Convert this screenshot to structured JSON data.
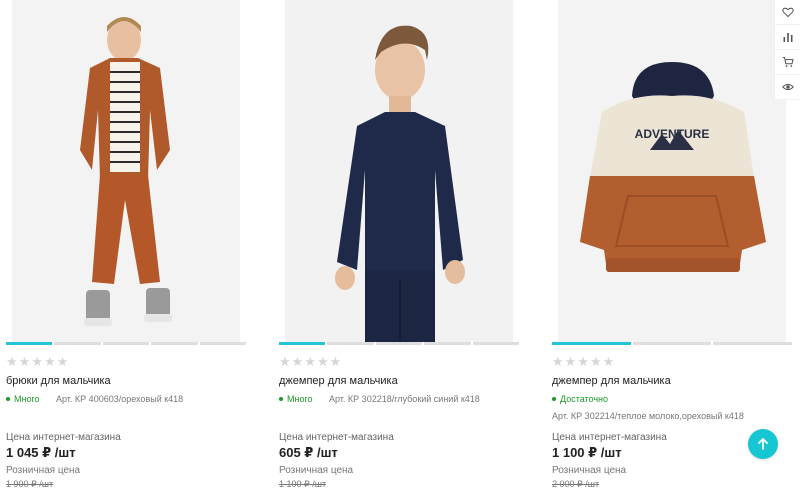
{
  "products": [
    {
      "title": "брюки для мальчика",
      "availability": "Много",
      "article": "Арт. КР 400603/ореховый к418",
      "price_label": "Цена интернет-магазина",
      "price": "1 045 ₽ /шт",
      "retail_label": "Розничная цена",
      "retail_price": "1 900 ₽ /шт",
      "image": "boy-in-brown-tracksuit-photo",
      "rating": 0
    },
    {
      "title": "джемпер для мальчика",
      "availability": "Много",
      "article": "Арт. КР 302218/глубокий синий к418",
      "price_label": "Цена интернет-магазина",
      "price": "605 ₽ /шт",
      "retail_label": "Розничная цена",
      "retail_price": "1 100 ₽ /шт",
      "image": "boy-in-navy-jumper-photo",
      "rating": 0
    },
    {
      "title": "джемпер для мальчика",
      "availability": "Достаточно",
      "article": "Арт. КР 302214/теплое молоко,ореховый к418",
      "price_label": "Цена интернет-магазина",
      "price": "1 100 ₽ /шт",
      "retail_label": "Розничная цена",
      "retail_price": "2 000 ₽ /шт",
      "image": "hoodie-product-photo",
      "hoodie_print": "ADVENTURE",
      "rating": 0
    }
  ],
  "side_actions": [
    "heart-icon",
    "compare-icon",
    "cart-icon",
    "eye-icon"
  ],
  "scroll_top_icon": "arrow-up-icon",
  "colors": {
    "accent": "#17c6d3",
    "availability": "#1d9a2a",
    "slider_active": "#23c4d6"
  }
}
